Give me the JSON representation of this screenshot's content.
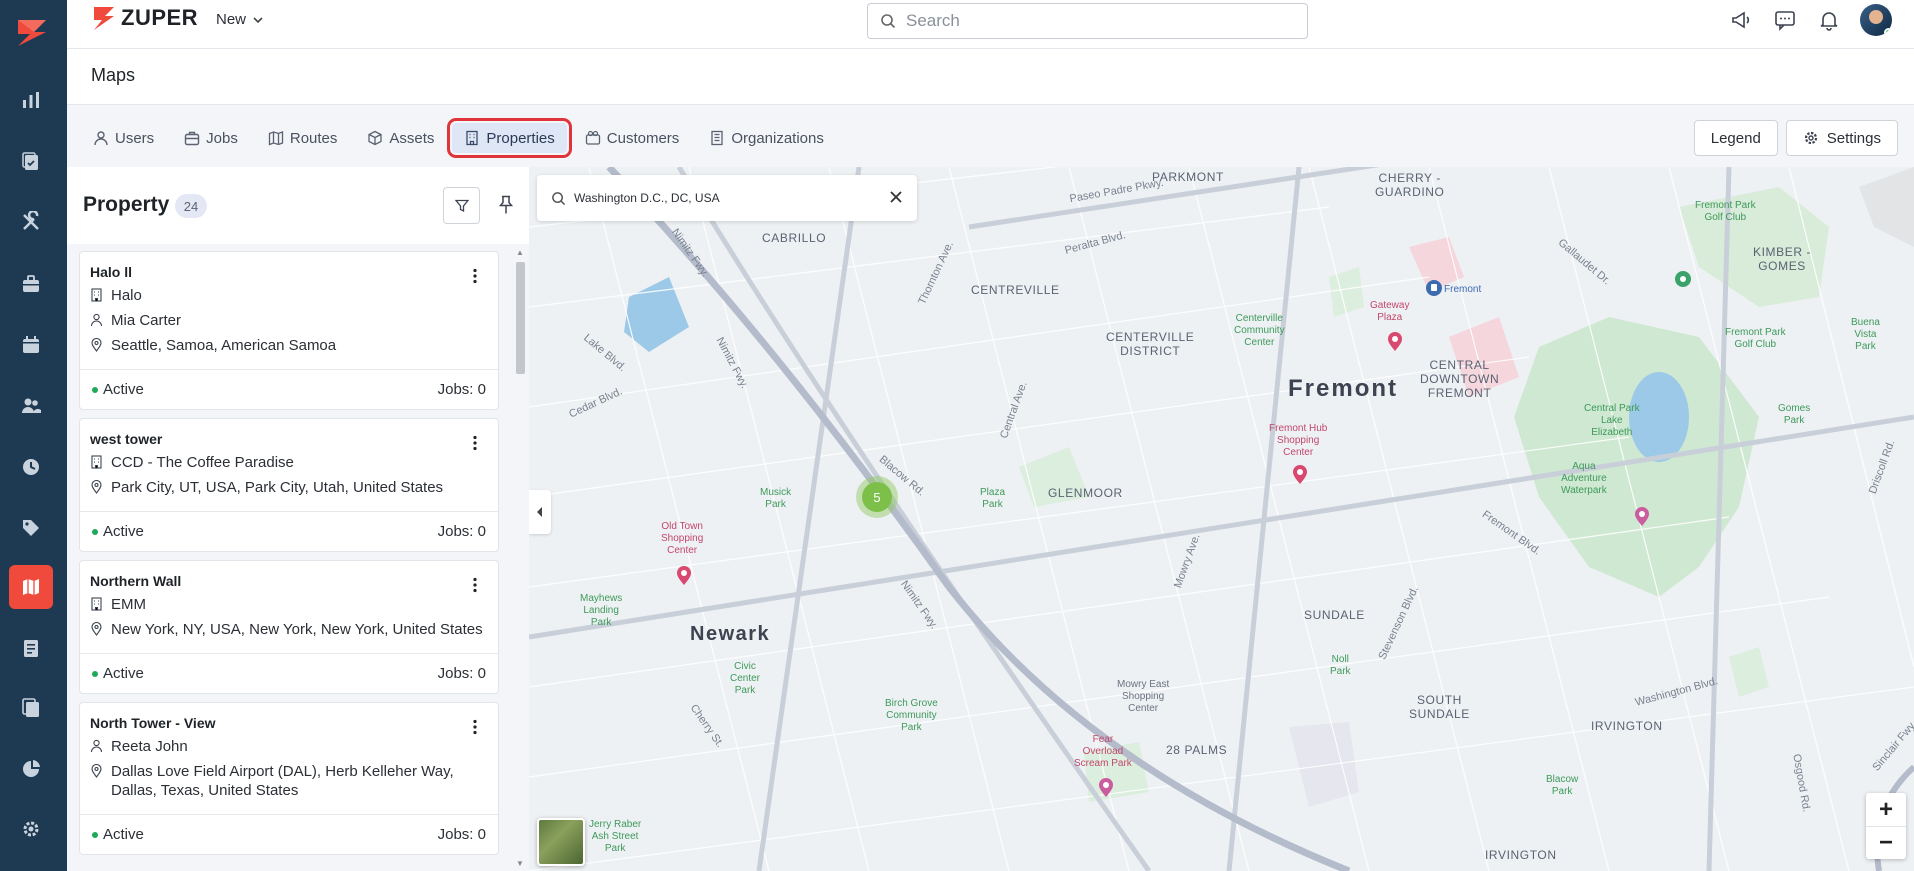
{
  "app": {
    "brand": "ZUPER",
    "new_menu_label": "New",
    "search_placeholder": "Search"
  },
  "page": {
    "title": "Maps"
  },
  "tabs": [
    {
      "label": "Users",
      "icon": "user-icon"
    },
    {
      "label": "Jobs",
      "icon": "briefcase-icon"
    },
    {
      "label": "Routes",
      "icon": "map-icon"
    },
    {
      "label": "Assets",
      "icon": "cube-icon"
    },
    {
      "label": "Properties",
      "icon": "building-icon",
      "selected": true
    },
    {
      "label": "Customers",
      "icon": "customers-icon"
    },
    {
      "label": "Organizations",
      "icon": "organization-icon"
    }
  ],
  "actions": {
    "legend_label": "Legend",
    "settings_label": "Settings"
  },
  "panel": {
    "title": "Property",
    "count": "24",
    "properties": [
      {
        "name": "Halo ll",
        "org": "Halo",
        "contact": "Mia Carter",
        "address": "Seattle, Samoa, American Samoa",
        "status": "Active",
        "jobs": "Jobs: 0"
      },
      {
        "name": "west tower",
        "org": "CCD - The Coffee Paradise",
        "contact": "",
        "address": "Park City, UT, USA, Park City, Utah, United States",
        "status": "Active",
        "jobs": "Jobs: 0"
      },
      {
        "name": "Northern Wall",
        "org": "EMM",
        "contact": "",
        "address": "New York, NY, USA, New York, New York, United States",
        "status": "Active",
        "jobs": "Jobs: 0"
      },
      {
        "name": "North Tower - View",
        "org": "",
        "contact": "Reeta John",
        "address": "Dallas Love Field Airport (DAL), Herb Kelleher Way, Dallas, Texas, United States",
        "status": "Active",
        "jobs": "Jobs: 0"
      }
    ]
  },
  "map": {
    "search_value": "Washington D.C., DC, USA",
    "cluster_count": "5",
    "zoom_in": "+",
    "zoom_out": "−",
    "labels": {
      "fremont": "Fremont",
      "newark": "Newark",
      "centerville_district": "CENTERVILLE\nDISTRICT",
      "centreville": "CENTREVILLE",
      "glenmoor": "GLENMOOR",
      "sundale": "SUNDALE",
      "south_sundale": "SOUTH\nSUNDALE",
      "irvington": "IRVINGTON",
      "irvington2": "IRVINGTON",
      "palms": "28 PALMS",
      "parkmont": "PARKMONT",
      "cherry_guardino": "CHERRY -\nGUARDINO",
      "kimber_gomes": "KIMBER -\nGOMES",
      "central_downtown": "CENTRAL\nDOWNTOWN\nFREMONT",
      "cabrillo": "CABRILLO"
    },
    "streets": {
      "paseo_padre_pkwy": "Paseo Padre Pkwy.",
      "peralta_blvd": "Peralta Blvd.",
      "thornton_ave": "Thornton Ave.",
      "nimitz_fwy": "Nimitz Fwy.",
      "nimitz_fwy2": "Nimitz Fwy.",
      "nimitz_fwy3": "Nimitz Fwy.",
      "lake_blvd": "Lake Blvd.",
      "cedar_blvd": "Cedar Blvd.",
      "blacow_rd": "Blacow Rd.",
      "mowry_ave": "Mowry Ave.",
      "central_ave": "Central Ave.",
      "fremont_blvd": "Fremont Blvd.",
      "stevenson_blvd": "Stevenson Blvd.",
      "washington_blvd": "Washington Blvd.",
      "gallaudet_dr": "Gallaudet Dr.",
      "cherry_st": "Cherry St.",
      "driscoll_rd": "Driscoll Rd.",
      "osgood_rd": "Osgood Rd.",
      "sinclair_fwy": "Sinclair Fwy."
    },
    "pois": {
      "centerville_community_center": "Centerville\nCommunity\nCenter",
      "gateway_plaza": "Gateway\nPlaza",
      "fremont_hub": "Fremont Hub\nShopping\nCenter",
      "old_town": "Old Town\nShopping\nCenter",
      "musick_park": "Musick\nPark",
      "plaza_park": "Plaza\nPark",
      "mayhews_landing": "Mayhews\nLanding\nPark",
      "civic_center_park": "Civic\nCenter\nPark",
      "birch_grove": "Birch Grove\nCommunity\nPark",
      "mowry_east": "Mowry East\nShopping\nCenter",
      "fear_overload": "Fear\nOverload\nScream Park",
      "central_park_lake": "Central Park\nLake\nElizabeth",
      "aqua_adventure": "Aqua\nAdventure\nWaterpark",
      "fremont_park_golf": "Fremont Park\nGolf Club",
      "fremont_park_golf2": "Fremont Park\nGolf Club",
      "gomes_park": "Gomes\nPark",
      "buena_vista": "Buena\nVista\nPark",
      "noll_park": "Noll\nPark",
      "blacow_park": "Blacow\nPark",
      "jerry_raber": "Jerry Raber\nAsh Street\nPark",
      "fremont_station": "Fremont"
    }
  }
}
